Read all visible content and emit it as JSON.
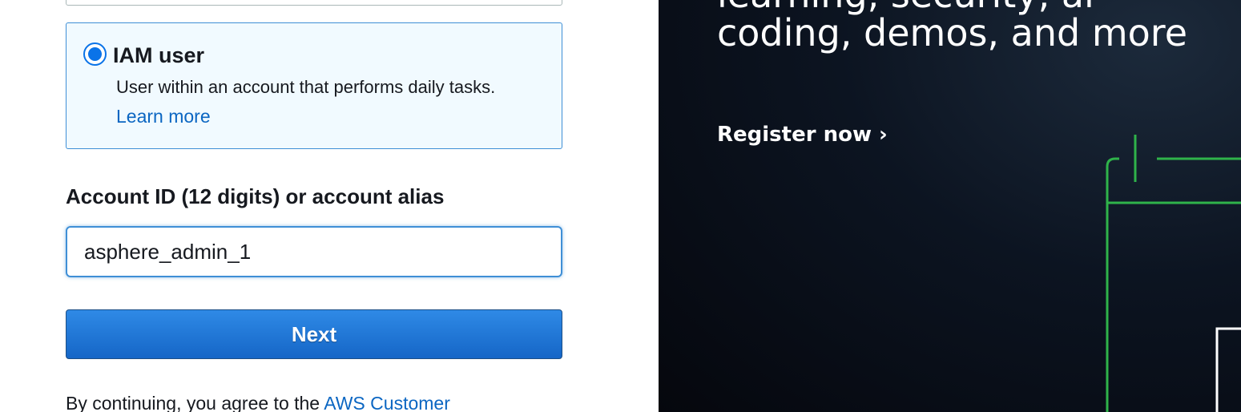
{
  "signin": {
    "iam_option": {
      "title": "IAM user",
      "description": "User within an account that performs daily tasks.",
      "learn_more": "Learn more",
      "selected": true
    },
    "account_field": {
      "label": "Account ID (12 digits) or account alias",
      "value": "asphere_admin_1"
    },
    "next_button": "Next",
    "terms": {
      "prefix": "By continuing, you agree to the ",
      "link": "AWS Customer"
    }
  },
  "promo": {
    "headline_partial": "learning, security, ai",
    "headline": "coding, demos, and more",
    "cta": "Register now ›"
  },
  "colors": {
    "accent_blue": "#0a73e8",
    "link_blue": "#0b66c2",
    "card_bg": "#f1faff",
    "circuit_green": "#2fb34a"
  }
}
